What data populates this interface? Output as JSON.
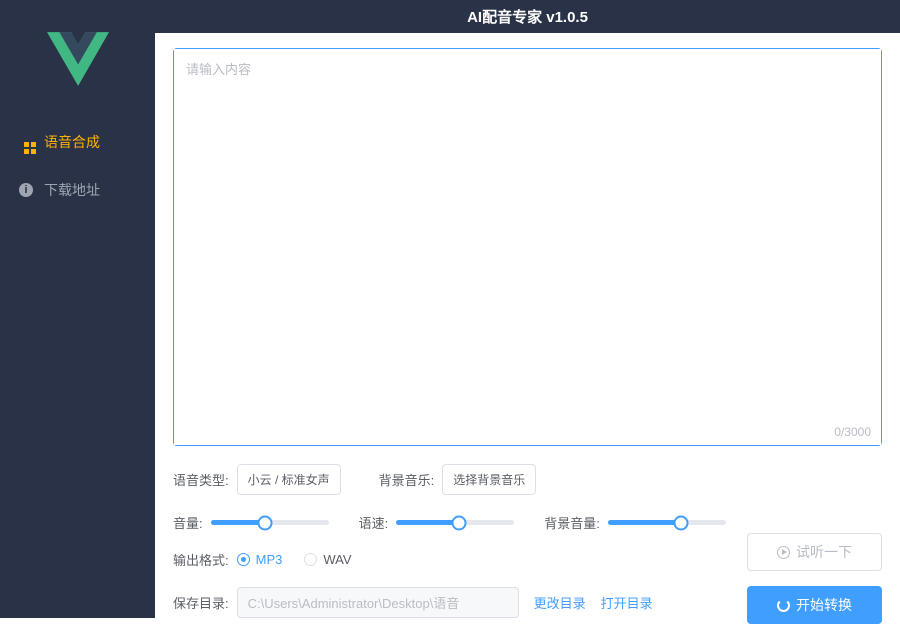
{
  "header": {
    "title": "AI配音专家 v1.0.5"
  },
  "sidebar": {
    "items": [
      {
        "label": "语音合成",
        "active": true
      },
      {
        "label": "下载地址",
        "active": false
      }
    ]
  },
  "editor": {
    "placeholder": "请输入内容",
    "value": "",
    "char_count": "0/3000"
  },
  "voice_type": {
    "label": "语音类型:",
    "value": "小云 / 标准女声"
  },
  "bg_music": {
    "label": "背景音乐:",
    "value": "选择背景音乐"
  },
  "sliders": {
    "volume": {
      "label": "音量:",
      "percent": 46
    },
    "speed": {
      "label": "语速:",
      "percent": 53
    },
    "bg_volume": {
      "label": "背景音量:",
      "percent": 62
    }
  },
  "output_format": {
    "label": "输出格式:",
    "options": [
      {
        "label": "MP3",
        "checked": true
      },
      {
        "label": "WAV",
        "checked": false
      }
    ]
  },
  "save_dir": {
    "label": "保存目录:",
    "path": "C:\\Users\\Administrator\\Desktop\\语音",
    "change_link": "更改目录",
    "open_link": "打开目录"
  },
  "buttons": {
    "preview": "试听一下",
    "convert": "开始转换"
  }
}
